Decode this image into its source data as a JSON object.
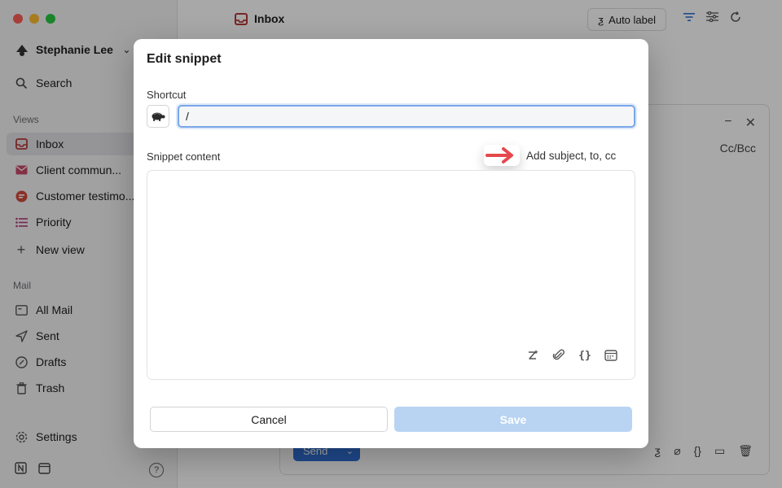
{
  "sidebar": {
    "account_name": "Stephanie Lee",
    "views_header": "Views",
    "views": [
      {
        "label": "Inbox",
        "icon": "inbox-icon",
        "active": true
      },
      {
        "label": "Client commun...",
        "icon": "mail-icon"
      },
      {
        "label": "Customer testimo...",
        "icon": "chat-icon"
      },
      {
        "label": "Priority",
        "icon": "list-icon"
      },
      {
        "label": "New view",
        "icon": "plus-icon"
      }
    ],
    "mail_header": "Mail",
    "mail": [
      {
        "label": "All Mail",
        "icon": "archive-icon"
      },
      {
        "label": "Sent",
        "icon": "send-icon"
      },
      {
        "label": "Drafts",
        "icon": "drafts-icon"
      },
      {
        "label": "Trash",
        "icon": "trash-icon"
      }
    ],
    "settings_label": "Settings",
    "help_glyph": "?"
  },
  "topbar": {
    "title": "Inbox",
    "auto_label": "Auto label"
  },
  "composer": {
    "cc_bcc": "Cc/Bcc",
    "send_label": "Send"
  },
  "modal": {
    "title": "Edit snippet",
    "shortcut_label": "Shortcut",
    "shortcut_value": "/",
    "content_label": "Snippet content",
    "add_subject_label": "Add subject, to, cc",
    "cancel_label": "Cancel",
    "save_label": "Save"
  },
  "colors": {
    "accent": "#2f6fd6",
    "save_disabled": "#b9d4f3",
    "arrow": "#e5484d",
    "focus_ring": "#7aa7e8"
  }
}
